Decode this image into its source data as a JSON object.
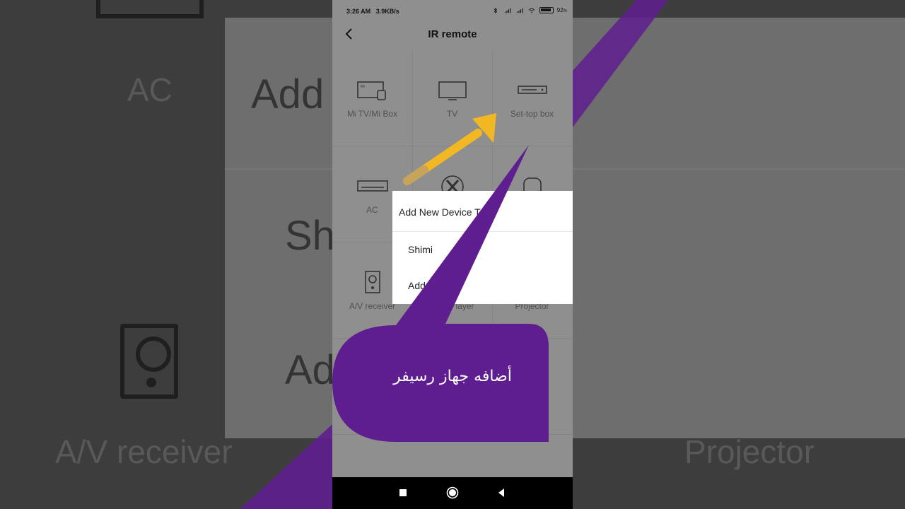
{
  "background": {
    "texts": [
      "AC",
      "Add",
      "Sh",
      "Add",
      "A/V receiver",
      "Projector"
    ]
  },
  "status_bar": {
    "time": "3:26 AM",
    "speed": "3.9KB/s",
    "battery": "92",
    "battery_unit": "%"
  },
  "app_bar": {
    "title": "IR remote",
    "back_icon": "chevron-left-icon"
  },
  "devices": [
    {
      "label": "Mi TV/Mi Box",
      "icon": "mi-tv-box-icon"
    },
    {
      "label": "TV",
      "icon": "tv-icon"
    },
    {
      "label": "Set-top box",
      "icon": "set-top-box-icon"
    },
    {
      "label": "AC",
      "icon": "ac-icon"
    },
    {
      "label": "",
      "icon": "fan-icon"
    },
    {
      "label": "",
      "icon": "camera-icon"
    },
    {
      "label": "A/V receiver",
      "icon": "speaker-icon"
    },
    {
      "label": "layer",
      "icon": "dvd-player-icon"
    },
    {
      "label": "Projector",
      "icon": "projector-icon"
    }
  ],
  "dialog": {
    "title": "Add New Device T",
    "options": [
      "Shimi",
      "Add"
    ]
  },
  "annotation": {
    "caption": "أضافه جهاز رسيفر",
    "arrow_color": "#F2B824",
    "bubble_color": "#5F1E8F"
  },
  "nav_bar": {
    "icons": [
      "square-recents-icon",
      "circle-home-icon",
      "triangle-back-icon"
    ]
  }
}
